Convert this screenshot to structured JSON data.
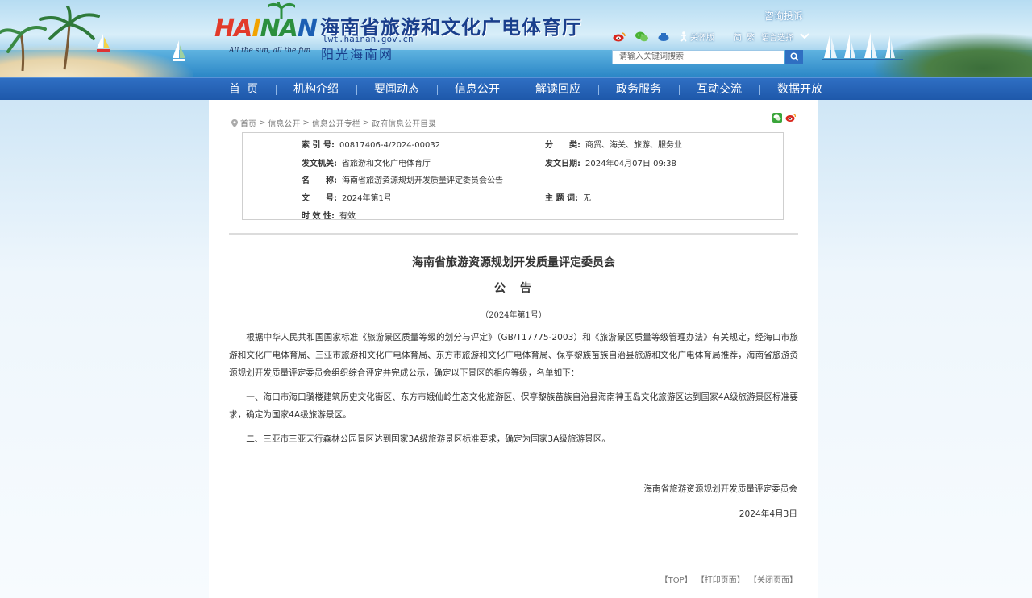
{
  "header": {
    "logo_text": [
      "HA",
      "I",
      "NA",
      "N"
    ],
    "logo_slogan": "All the sun, all the fun",
    "site_title": "海南省旅游和文化广电体育厅",
    "site_domain": "lwt.hainan.gov.cn",
    "site_sub": "阳光海南网",
    "consult_link": "咨询投诉",
    "tools": {
      "care_label": "关怀版",
      "simplified": "简",
      "traditional": "繁",
      "language": "语言选择"
    },
    "search": {
      "placeholder": "请输入关键词搜索"
    }
  },
  "nav": {
    "items": [
      "首页",
      "机构介绍",
      "要闻动态",
      "信息公开",
      "解读回应",
      "政务服务",
      "互动交流",
      "数据开放"
    ]
  },
  "breadcrumb": [
    "首页",
    "信息公开",
    "信息公开专栏",
    "政府信息公开目录"
  ],
  "meta": {
    "index_label": "索 引 号:",
    "index_value": "00817406-4/2024-00032",
    "category_label": "分　　类:",
    "category_value": "商贸、海关、旅游、服务业",
    "issuer_label": "发文机关:",
    "issuer_value": "省旅游和文化广电体育厅",
    "date_label": "发文日期:",
    "date_value": "2024年04月07日 09:38",
    "name_label": "名　　称:",
    "name_value": "海南省旅游资源规划开发质量评定委员会公告",
    "docno_label": "文　　号:",
    "docno_value": "2024年第1号",
    "subject_label": "主 题 词:",
    "subject_value": "无",
    "validity_label": "时 效 性:",
    "validity_value": "有效"
  },
  "article": {
    "title1": "海南省旅游资源规划开发质量评定委员会",
    "title2": "公　告",
    "number": "（2024年第1号）",
    "p1": "根据中华人民共和国国家标准《旅游景区质量等级的划分与评定》（GB/T17775-2003）和《旅游景区质量等级管理办法》有关规定，经海口市旅游和文化广电体育局、三亚市旅游和文化广电体育局、东方市旅游和文化广电体育局、保亭黎族苗族自治县旅游和文化广电体育局推荐，海南省旅游资源规划开发质量评定委员会组织综合评定并完成公示，确定以下景区的相应等级，名单如下：",
    "p2": "一、海口市海口骑楼建筑历史文化街区、东方市娥仙岭生态文化旅游区、保亭黎族苗族自治县海南神玉岛文化旅游区达到国家4A级旅游景区标准要求，确定为国家4A级旅游景区。",
    "p3": "二、三亚市三亚天行森林公园景区达到国家3A级旅游景区标准要求，确定为国家3A级旅游景区。",
    "signer": "海南省旅游资源规划开发质量评定委员会",
    "sign_date": "2024年4月3日"
  },
  "footer": {
    "top": "【TOP】",
    "print": "【打印页面】",
    "close": "【关闭页面】"
  },
  "colors": {
    "nav_bg": "#1d57a9",
    "title_blue": "#1a3f8c"
  }
}
